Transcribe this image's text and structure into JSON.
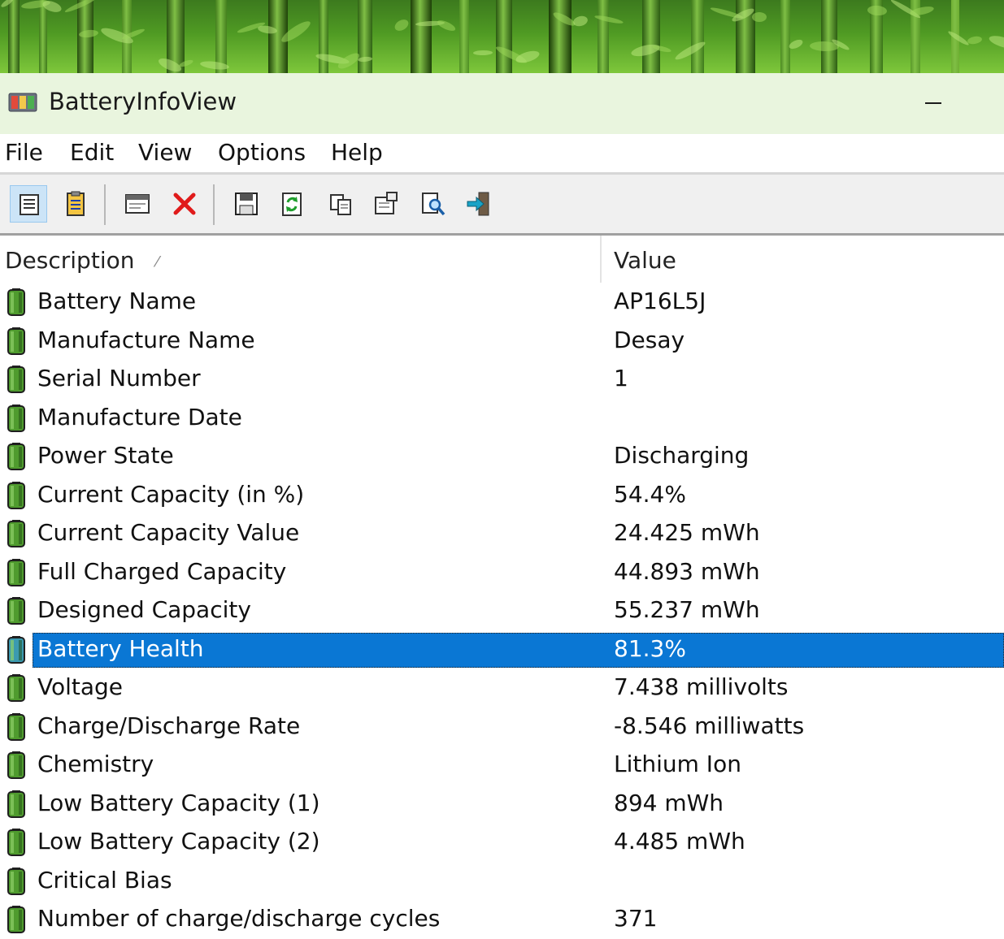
{
  "window": {
    "title": "BatteryInfoView",
    "minimize_label": "minimize"
  },
  "menu": [
    {
      "label": "File"
    },
    {
      "label": "Edit"
    },
    {
      "label": "View"
    },
    {
      "label": "Options"
    },
    {
      "label": "Help"
    }
  ],
  "toolbar": [
    {
      "icon": "battery-info-icon",
      "pressed": true
    },
    {
      "icon": "battery-log-icon",
      "pressed": false
    },
    {
      "icon": "log-window-icon",
      "pressed": false
    },
    {
      "icon": "delete-icon",
      "pressed": false
    },
    {
      "icon": "save-icon",
      "pressed": false
    },
    {
      "icon": "refresh-icon",
      "pressed": false
    },
    {
      "icon": "copy-icon",
      "pressed": false
    },
    {
      "icon": "properties-icon",
      "pressed": false
    },
    {
      "icon": "find-icon",
      "pressed": false
    },
    {
      "icon": "exit-icon",
      "pressed": false
    }
  ],
  "list": {
    "columns": {
      "description": "Description",
      "value": "Value",
      "sort_glyph": "⁄"
    },
    "rows": [
      {
        "description": "Battery Name",
        "value": "AP16L5J"
      },
      {
        "description": "Manufacture Name",
        "value": "Desay"
      },
      {
        "description": "Serial Number",
        "value": "1"
      },
      {
        "description": "Manufacture Date",
        "value": ""
      },
      {
        "description": "Power State",
        "value": "Discharging"
      },
      {
        "description": "Current Capacity (in %)",
        "value": "54.4%"
      },
      {
        "description": "Current Capacity Value",
        "value": "24.425 mWh"
      },
      {
        "description": "Full Charged Capacity",
        "value": "44.893 mWh"
      },
      {
        "description": "Designed Capacity",
        "value": "55.237 mWh"
      },
      {
        "description": "Battery Health",
        "value": "81.3%",
        "selected": true
      },
      {
        "description": "Voltage",
        "value": "7.438 millivolts"
      },
      {
        "description": "Charge/Discharge Rate",
        "value": "-8.546 milliwatts"
      },
      {
        "description": "Chemistry",
        "value": "Lithium Ion"
      },
      {
        "description": "Low Battery Capacity (1)",
        "value": "894 mWh"
      },
      {
        "description": "Low Battery Capacity (2)",
        "value": "4.485 mWh"
      },
      {
        "description": "Critical Bias",
        "value": ""
      },
      {
        "description": "Number of charge/discharge cycles",
        "value": "371"
      }
    ]
  },
  "colors": {
    "selection": "#0a77d4",
    "titlebar": "#e9f5de",
    "battery_green": "#4f9b2e"
  }
}
